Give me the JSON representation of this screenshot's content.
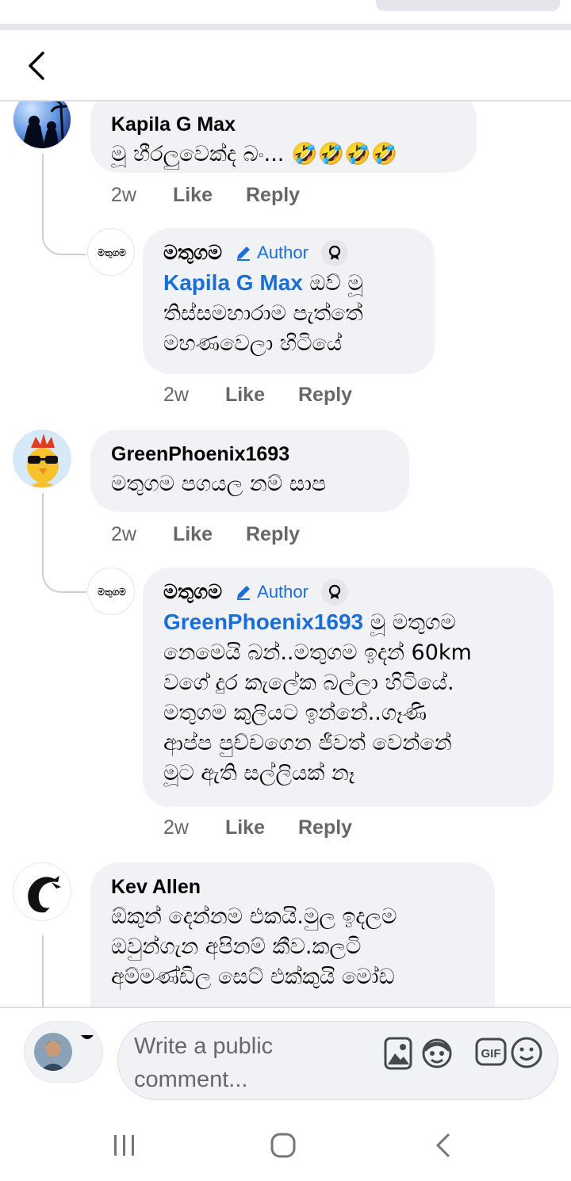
{
  "comments": [
    {
      "id": "c1",
      "name": "Kapila G Max",
      "text": "මූ හීරලුවෙක්ද බං... 🤣🤣🤣🤣",
      "time": "2w",
      "like": "Like",
      "reply": "Reply"
    },
    {
      "id": "r1",
      "name": "මතුගම",
      "author_label": "Author",
      "mention": "Kapila G Max",
      "text_after_mention": " ඔව් මූ",
      "text_lines": [
        "තිස්සමහාරාම පැත්තේ",
        "මහණවෙලා හිටියේ"
      ],
      "time": "2w",
      "like": "Like",
      "reply": "Reply"
    },
    {
      "id": "c2",
      "name": "GreenPhoenix1693",
      "text": "මතුගම පගයල නම් සාප",
      "time": "2w",
      "like": "Like",
      "reply": "Reply"
    },
    {
      "id": "r2",
      "name": "මතුගම",
      "author_label": "Author",
      "mention": "GreenPhoenix1693",
      "text_after_mention": " මූ මතුගම",
      "text_lines": [
        "නෙමෙයි බන්..මතුගම ඉදන් 60km",
        "වගේ දුර කැලේක බල්ලා හිටියේ.",
        "මතුගම කුලියට ඉන්නේ..ගෑණි",
        "ආප්ප පුච්චගෙන ජීවත් වෙන්නේ",
        "මූට ඇති සල්ලියක් නෑ"
      ],
      "time": "2w",
      "like": "Like",
      "reply": "Reply"
    },
    {
      "id": "c3",
      "name": "Kev Allen",
      "text_lines": [
        "ඕකුන් දෙන්නම එකයි.මුල ඉදලම",
        "ඔවුන්ගැන අපිනම් කීව.කලටි",
        "අම්මණ්ඩිල සෙට් එක්කුයි මෝඩ"
      ]
    }
  ],
  "composer": {
    "placeholder_line1": "Write a public",
    "placeholder_line2": "comment..."
  },
  "page_avatar_text": "මතුගම"
}
